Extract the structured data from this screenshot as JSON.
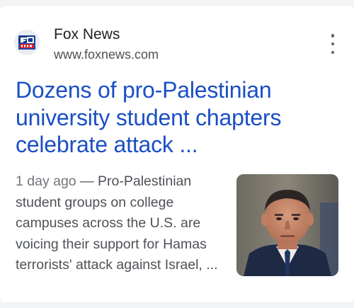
{
  "result": {
    "source": {
      "name": "Fox News",
      "url": "www.foxnews.com",
      "logo_icon": "fox-news-logo"
    },
    "headline_lines": [
      "Dozens of pro-Palestinian",
      "university student chapters",
      "celebrate attack ..."
    ],
    "snippet": {
      "age": "1 day ago",
      "separator": " — ",
      "text": "Pro-Palestinian student groups on college campuses across the U.S. are voicing their support for Hamas terrorists' attack against Israel, ..."
    },
    "thumbnail_icon": "portrait-photo",
    "more_icon": "more-vert-icon"
  },
  "colors": {
    "headline": "#1a4fc4",
    "source_name": "#202124",
    "url": "#4d5156",
    "snippet": "#4d5156",
    "logo_blue": "#143a8a",
    "logo_red": "#d8212a"
  }
}
